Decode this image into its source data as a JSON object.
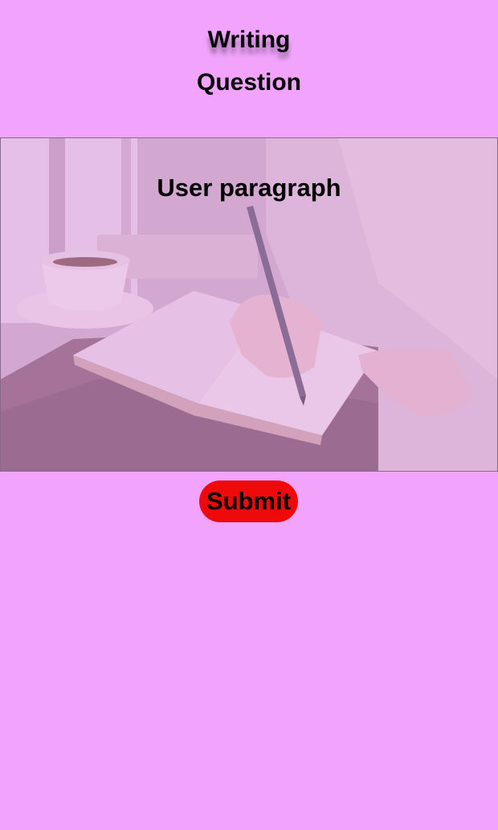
{
  "colors": {
    "page_background": "#f2a4fd",
    "submit_background": "#ee0a0a",
    "text": "#000000"
  },
  "header": {
    "title": "Writing",
    "subtitle": "Question"
  },
  "photo": {
    "subject": "hands-writing-in-notebook-photo",
    "overlay_label": "User paragraph"
  },
  "actions": {
    "submit_label": "Submit"
  }
}
